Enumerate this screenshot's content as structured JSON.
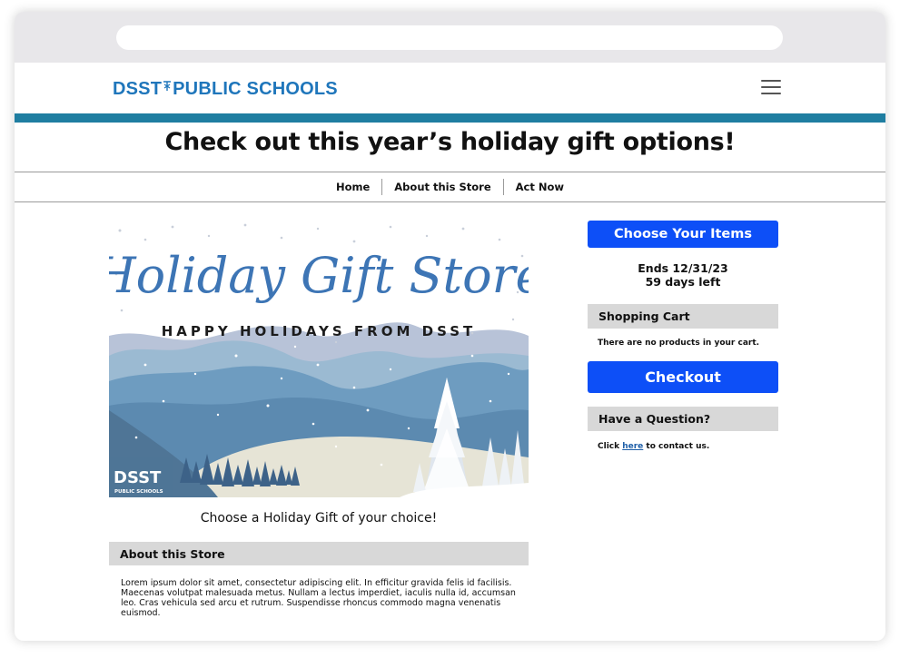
{
  "header": {
    "logo_left": "DSST",
    "logo_right": "PUBLIC SCHOOLS"
  },
  "headline": "Check out this year’s holiday gift options!",
  "nav": {
    "items": [
      "Home",
      "About this Store",
      "Act Now"
    ]
  },
  "hero": {
    "script_title": "Holiday Gift Store",
    "subtitle": "HAPPY HOLIDAYS FROM DSST",
    "badge_big": "DSST",
    "badge_small": "PUBLIC SCHOOLS"
  },
  "caption": "Choose a Holiday Gift of your choice!",
  "about": {
    "heading": "About this Store",
    "body": "Lorem ipsum dolor sit amet, consectetur adipiscing elit. In efficitur gravida felis id facilisis. Maecenas volutpat malesuada metus. Nullam a lectus imperdiet, iaculis nulla id, accumsan leo. Cras vehicula sed arcu et rutrum. Suspendisse rhoncus commodo magna venenatis euismod."
  },
  "sidebar": {
    "choose_label": "Choose Your Items",
    "ends_label": "Ends 12/31/23",
    "days_left": "59 days left",
    "cart_heading": "Shopping Cart",
    "cart_empty": "There are no products in your cart.",
    "checkout_label": "Checkout",
    "question_heading": "Have a Question?",
    "contact_prefix": "Click ",
    "contact_link": "here",
    "contact_suffix": " to contact us."
  },
  "colors": {
    "brand_blue": "#1f76bb",
    "accent_bar": "#1f7ea1",
    "cta_blue": "#0d4ff7",
    "section_grey": "#d8d8d8"
  },
  "icons": {
    "menu": "hamburger-menu-icon"
  }
}
